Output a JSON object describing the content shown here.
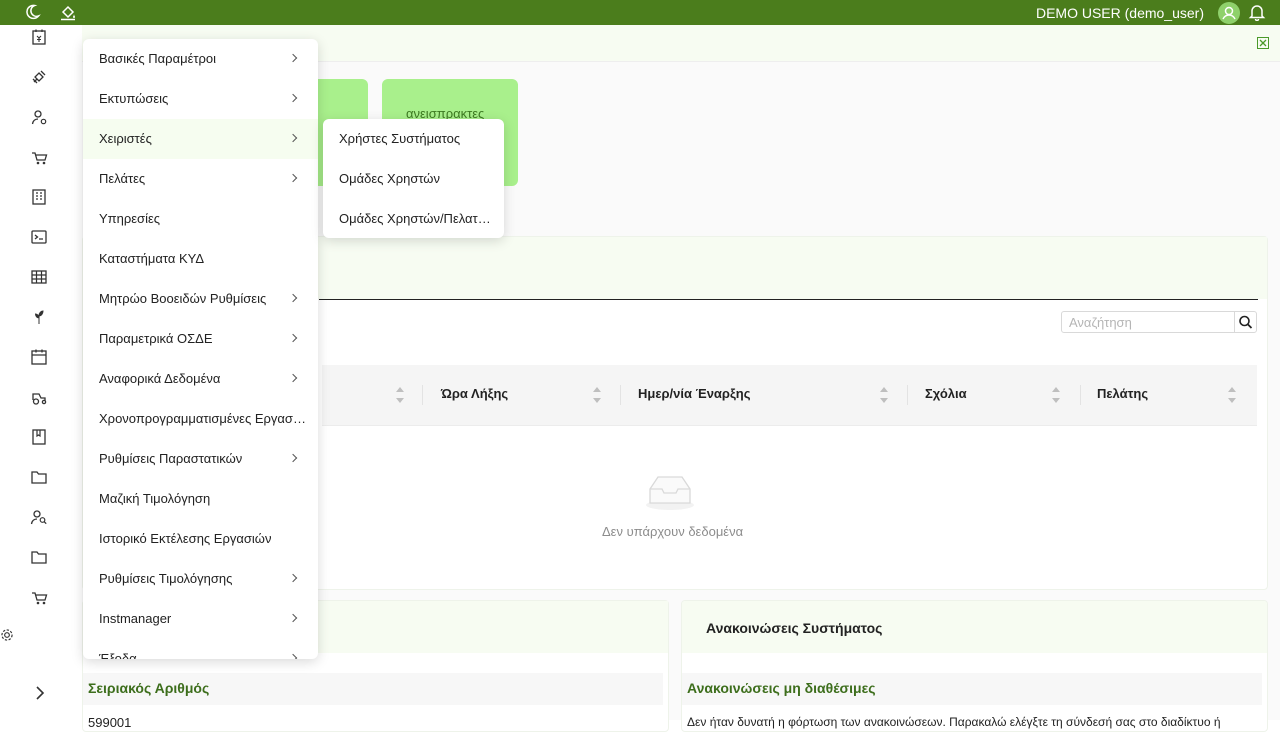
{
  "header": {
    "user": "DEMO USER (demo_user)",
    "accent": "#4b7d1c"
  },
  "sidebar": {
    "icons": [
      "cash-register-icon",
      "satellite-icon",
      "user-settings-icon",
      "tractor-cart-icon",
      "building-icon",
      "terminal-icon",
      "table-grid-icon",
      "plant-icon",
      "calendar-icon",
      "tractor-icon",
      "book-icon",
      "folder-icon",
      "users-search-icon",
      "folder-icon",
      "tractor-cart-icon",
      "gear-icon",
      "chevron-right-icon"
    ]
  },
  "cards": [
    {
      "label": "ανεισπρακτες"
    }
  ],
  "search": {
    "placeholder": "Αναζήτηση"
  },
  "table": {
    "columns": [
      "Ώρα Λήξης",
      "Ημερ/νία Έναρξης",
      "Σχόλια",
      "Πελάτης"
    ],
    "empty_text": "Δεν υπάρχουν δεδομένα"
  },
  "bottom_left": {
    "row_title": "Σειριακός Αριθμός",
    "row_value": "599001"
  },
  "announcements": {
    "title": "Ανακοινώσεις Συστήματος",
    "subtitle": "Ανακοινώσεις μη διαθέσιμες",
    "body": "Δεν ήταν δυνατή η φόρτωση των ανακοινώσεων. Παρακαλώ ελέγξτε τη σύνδεσή σας στο διαδίκτυο ή"
  },
  "menu": {
    "items": [
      {
        "label": "Βασικές Παραμέτροι",
        "submenu": true
      },
      {
        "label": "Εκτυπώσεις",
        "submenu": true
      },
      {
        "label": "Χειριστές",
        "submenu": true
      },
      {
        "label": "Πελάτες",
        "submenu": true
      },
      {
        "label": "Υπηρεσίες",
        "submenu": false
      },
      {
        "label": "Καταστήματα ΚΥΔ",
        "submenu": false
      },
      {
        "label": "Μητρώο Βοοειδών Ρυθμίσεις",
        "submenu": true
      },
      {
        "label": "Παραμετρικά ΟΣΔΕ",
        "submenu": true
      },
      {
        "label": "Αναφορικά Δεδομένα",
        "submenu": true
      },
      {
        "label": "Χρονοπρογραμματισμένες Εργασ…",
        "submenu": false
      },
      {
        "label": "Ρυθμίσεις Παραστατικών",
        "submenu": true
      },
      {
        "label": "Μαζική Τιμολόγηση",
        "submenu": false
      },
      {
        "label": "Ιστορικό Εκτέλεσης Εργασιών",
        "submenu": false
      },
      {
        "label": "Ρυθμίσεις Τιμολόγησης",
        "submenu": true
      },
      {
        "label": "Instmanager",
        "submenu": true
      },
      {
        "label": "Έξοδα",
        "submenu": true
      }
    ]
  },
  "submenu": {
    "items": [
      {
        "label": "Χρήστες Συστήματος"
      },
      {
        "label": "Ομάδες Χρηστών"
      },
      {
        "label": "Ομάδες Χρηστών/Πελατ…"
      }
    ]
  }
}
